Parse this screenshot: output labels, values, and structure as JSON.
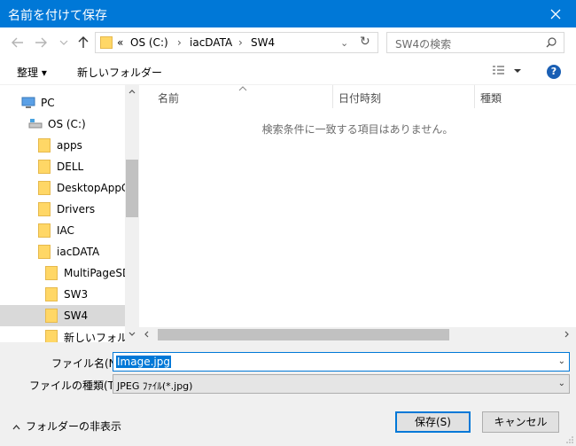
{
  "window": {
    "title": "名前を付けて保存"
  },
  "address": {
    "prefix": "«",
    "crumbs": [
      "OS (C:)",
      "iacDATA",
      "SW4"
    ],
    "separator": "›"
  },
  "search": {
    "placeholder": "SW4の検索"
  },
  "toolbar": {
    "organize": "整理 ▾",
    "new_folder": "新しいフォルダー"
  },
  "tree": {
    "items": [
      {
        "label": "PC",
        "icon": "pc-icon"
      },
      {
        "label": "OS (C:)",
        "icon": "drive-icon"
      },
      {
        "label": "apps",
        "icon": "folder-icon"
      },
      {
        "label": "DELL",
        "icon": "folder-icon"
      },
      {
        "label": "DesktopAppC",
        "icon": "folder-icon"
      },
      {
        "label": "Drivers",
        "icon": "folder-icon"
      },
      {
        "label": "IAC",
        "icon": "folder-icon"
      },
      {
        "label": "iacDATA",
        "icon": "folder-icon"
      },
      {
        "label": "MultiPageSD",
        "icon": "folder-icon"
      },
      {
        "label": "SW3",
        "icon": "folder-icon"
      },
      {
        "label": "SW4",
        "icon": "folder-icon"
      },
      {
        "label": "新しいフォルダー",
        "icon": "folder-icon"
      }
    ]
  },
  "files": {
    "columns": [
      "名前",
      "日付時刻",
      "種類"
    ],
    "empty_message": "検索条件に一致する項目はありません。"
  },
  "save": {
    "filename_label": "ファイル名(N):",
    "filename_value": "Image.jpg",
    "filetype_label": "ファイルの種類(T):",
    "filetype_value": "JPEG ﾌｧｲﾙ(*.jpg)",
    "hide_folders": "フォルダーの非表示",
    "save_button": "保存(S)",
    "cancel_button": "キャンセル"
  },
  "colors": {
    "accent": "#0078d7",
    "selected_row": "#d9d9d9"
  }
}
